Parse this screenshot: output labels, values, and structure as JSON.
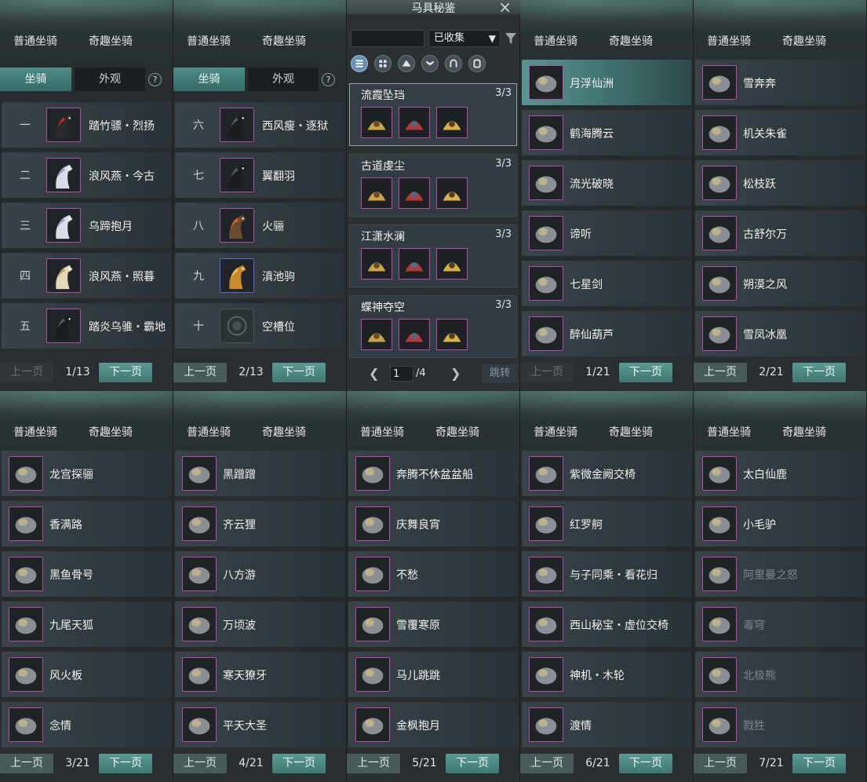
{
  "tabs": {
    "normal": "普通坐骑",
    "fun": "奇趣坐骑"
  },
  "subtabs": {
    "mount": "坐骑",
    "appearance": "外观",
    "help": "?"
  },
  "pager": {
    "prev": "上一页",
    "next": "下一页"
  },
  "colors": {
    "accent": "#4f8d88",
    "rare_border": "#b04fae",
    "epic_border": "#4f6fd0"
  },
  "panels": [
    {
      "page": "1/13",
      "prev_disabled": true,
      "rows": [
        {
          "num": "一",
          "name": "踏竹骠・烈扬",
          "icon": "horse-red-mane-icon"
        },
        {
          "num": "二",
          "name": "浪风燕・今古",
          "icon": "horse-white-icon"
        },
        {
          "num": "三",
          "name": "乌蹄抱月",
          "icon": "horse-white-icon"
        },
        {
          "num": "四",
          "name": "浪风燕・照暮",
          "icon": "horse-cream-icon"
        },
        {
          "num": "五",
          "name": "踏炎乌骓・霸地",
          "icon": "horse-black-icon"
        }
      ]
    },
    {
      "page": "2/13",
      "prev_disabled": false,
      "rows": [
        {
          "num": "六",
          "name": "西风瘦・逐狱",
          "icon": "horse-black-icon"
        },
        {
          "num": "七",
          "name": "翼翻羽",
          "icon": "horse-black-icon"
        },
        {
          "num": "八",
          "name": "火骊",
          "icon": "horse-brown-icon"
        },
        {
          "num": "九",
          "name": "滇池驹",
          "icon": "horse-gold-icon"
        },
        {
          "num": "十",
          "name": "空槽位",
          "icon": "empty-slot-icon"
        }
      ]
    },
    {
      "page": "1/21",
      "prev_disabled": true,
      "rows": [
        {
          "name": "月浮仙洲",
          "icon": "boat-moon-icon",
          "selected": true
        },
        {
          "name": "鹤海腾云",
          "icon": "crane-icon"
        },
        {
          "name": "流光破晓",
          "icon": "dragon-icon"
        },
        {
          "name": "谛听",
          "icon": "beast-icon"
        },
        {
          "name": "七星剑",
          "icon": "sword-icon"
        },
        {
          "name": "醉仙葫芦",
          "icon": "gourd-icon"
        }
      ]
    },
    {
      "page": "2/21",
      "prev_disabled": false,
      "rows": [
        {
          "name": "雪奔奔",
          "icon": "rabbit-icon"
        },
        {
          "name": "机关朱雀",
          "icon": "mech-bird-icon"
        },
        {
          "name": "松枝跃",
          "icon": "squirrel-icon"
        },
        {
          "name": "古舒尔万",
          "icon": "yak-icon"
        },
        {
          "name": "朔漠之风",
          "icon": "cart-icon"
        },
        {
          "name": "雪凤冰凰",
          "icon": "phoenix-icon"
        }
      ]
    },
    {
      "page": "3/21",
      "prev_disabled": false,
      "rows": [
        {
          "name": "龙宫探骊",
          "icon": "shell-icon"
        },
        {
          "name": "香满路",
          "icon": "flower-cart-icon"
        },
        {
          "name": "黑鱼骨号",
          "icon": "boat-icon"
        },
        {
          "name": "九尾天狐",
          "icon": "fox-icon"
        },
        {
          "name": "风火板",
          "icon": "skateboard-icon"
        },
        {
          "name": "念情",
          "icon": "leaf-icon"
        }
      ]
    },
    {
      "page": "4/21",
      "prev_disabled": false,
      "rows": [
        {
          "name": "黑蹭蹭",
          "icon": "pot-icon"
        },
        {
          "name": "齐云狸",
          "icon": "cat-icon"
        },
        {
          "name": "八方游",
          "icon": "carriage-icon"
        },
        {
          "name": "万顷波",
          "icon": "boat-icon"
        },
        {
          "name": "寒天獠牙",
          "icon": "mammoth-icon"
        },
        {
          "name": "平天大圣",
          "icon": "bull-icon"
        }
      ]
    },
    {
      "page": "5/21",
      "prev_disabled": false,
      "rows": [
        {
          "name": "奔腾不休盆盆船",
          "icon": "basin-boat-icon"
        },
        {
          "name": "庆舞良宵",
          "icon": "lion-dance-icon"
        },
        {
          "name": "不愁",
          "icon": "bird-icon"
        },
        {
          "name": "雪覆寒原",
          "icon": "deer-icon"
        },
        {
          "name": "马儿跳跳",
          "icon": "donkey-icon"
        },
        {
          "name": "金枫抱月",
          "icon": "ball-icon"
        }
      ]
    },
    {
      "page": "6/21",
      "prev_disabled": false,
      "rows": [
        {
          "name": "紫微金阙交椅",
          "icon": "chair-icon"
        },
        {
          "name": "红罗舸",
          "icon": "red-boat-icon"
        },
        {
          "name": "与子同乘・看花归",
          "icon": "umbrella-horse-icon"
        },
        {
          "name": "西山秘宝・虚位交椅",
          "icon": "girl-portrait-icon"
        },
        {
          "name": "神机・木轮",
          "icon": "wheel-icon"
        },
        {
          "name": "渡情",
          "icon": "bamboo-raft-icon"
        }
      ]
    },
    {
      "page": "7/21",
      "prev_disabled": false,
      "rows": [
        {
          "name": "太白仙鹿",
          "icon": "antler-icon"
        },
        {
          "name": "小毛驴",
          "icon": "donkey-icon"
        },
        {
          "name": "阿里曼之怒",
          "icon": "demon-icon",
          "dim": true
        },
        {
          "name": "毒穹",
          "icon": "tree-icon",
          "dim": true
        },
        {
          "name": "北极熊",
          "icon": "bear-icon",
          "dim": true
        },
        {
          "name": "戮狌",
          "icon": "ape-icon",
          "dim": true
        }
      ]
    }
  ],
  "center": {
    "title": "马具秘鉴",
    "search_placeholder": "",
    "filter_value": "已收集",
    "page_value": "1",
    "page_total": "/4",
    "jump": "跳转",
    "category_icons": [
      "list-icon",
      "grid-icon",
      "saddle-icon",
      "chest-armor-icon",
      "horseshoe-icon",
      "stirrup-icon"
    ],
    "sets": [
      {
        "name": "流霞坠珰",
        "count": "3/3",
        "pieces": [
          "gold-head-armor-icon",
          "red-saddle-icon",
          "horn-icon"
        ]
      },
      {
        "name": "古道虔尘",
        "count": "3/3",
        "pieces": [
          "gold-bridle-icon",
          "gold-saddle-icon",
          "gold-horn-icon"
        ]
      },
      {
        "name": "江潇水澜",
        "count": "3/3",
        "pieces": [
          "blue-chest-icon",
          "red-saddle-icon",
          "blue-helm-icon"
        ]
      },
      {
        "name": "蝶神夺空",
        "count": "3/3",
        "pieces": [
          "tail-ornament-icon",
          "purple-saddle-icon",
          "blue-helm-icon"
        ]
      }
    ]
  }
}
